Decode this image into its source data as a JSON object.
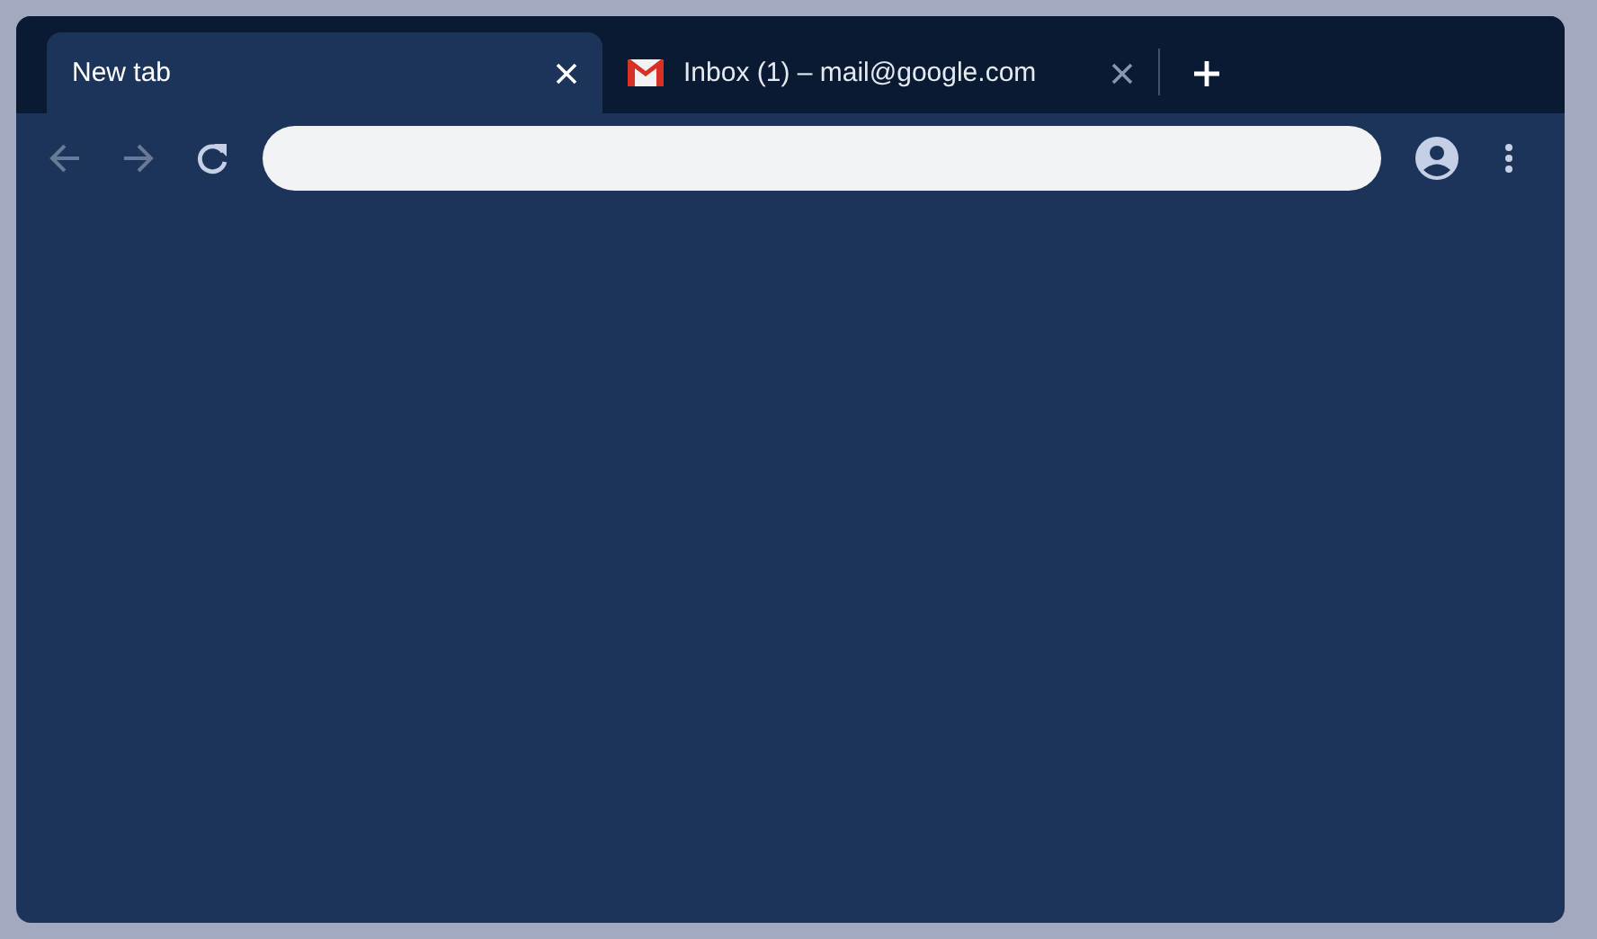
{
  "tabs": [
    {
      "title": "New tab",
      "selected": true,
      "favicon": false
    },
    {
      "title": "Inbox (1) – mail@google.com",
      "selected": false,
      "favicon": true
    }
  ],
  "toolbar": {
    "back_disabled": true,
    "forward_disabled": true
  }
}
